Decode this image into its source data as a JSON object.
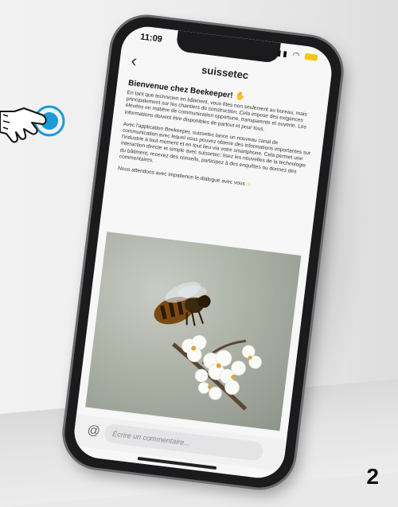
{
  "status": {
    "time": "11:09"
  },
  "nav": {
    "title": "suissetec"
  },
  "post": {
    "title": "Bienvenue chez Beekeeper!",
    "paragraph_1": "En tant que technicien en bâtiment, vous êtes non seulement au bureau, mais principalement sur les chantiers de construction. Cela impose des exigences élevées en matière de communication opportune, transparente et ouverte. Les informations doivent être disponibles de partout et pour tous.",
    "paragraph_2": "Avec l'application Beekeeper, suissetec lance un nouveau canal de communication avec lequel vous pouvez obtenir des informations importantes sur l'industrie à tout moment et en tout lieu via votre smartphone. Cela permet une interaction directe et simple avec suissetec: lisez les nouvelles de la technologie du bâtiment, recevez des conseils, participez à des enquêtes ou donnez des commentaires.",
    "paragraph_3": "Nous attendons avec impatience le dialogue avec vous"
  },
  "comment": {
    "placeholder": "Écrire un commentaire..."
  },
  "step_number": "2",
  "colors": {
    "accent_touch": "#1a9ad8",
    "emoji": "#e8b400",
    "phone_frame": "#1b1b1d"
  },
  "icons": [
    "back-chevron-icon",
    "at-icon",
    "touch-hand-icon",
    "wave-emoji-icon",
    "smile-emoji-icon"
  ]
}
